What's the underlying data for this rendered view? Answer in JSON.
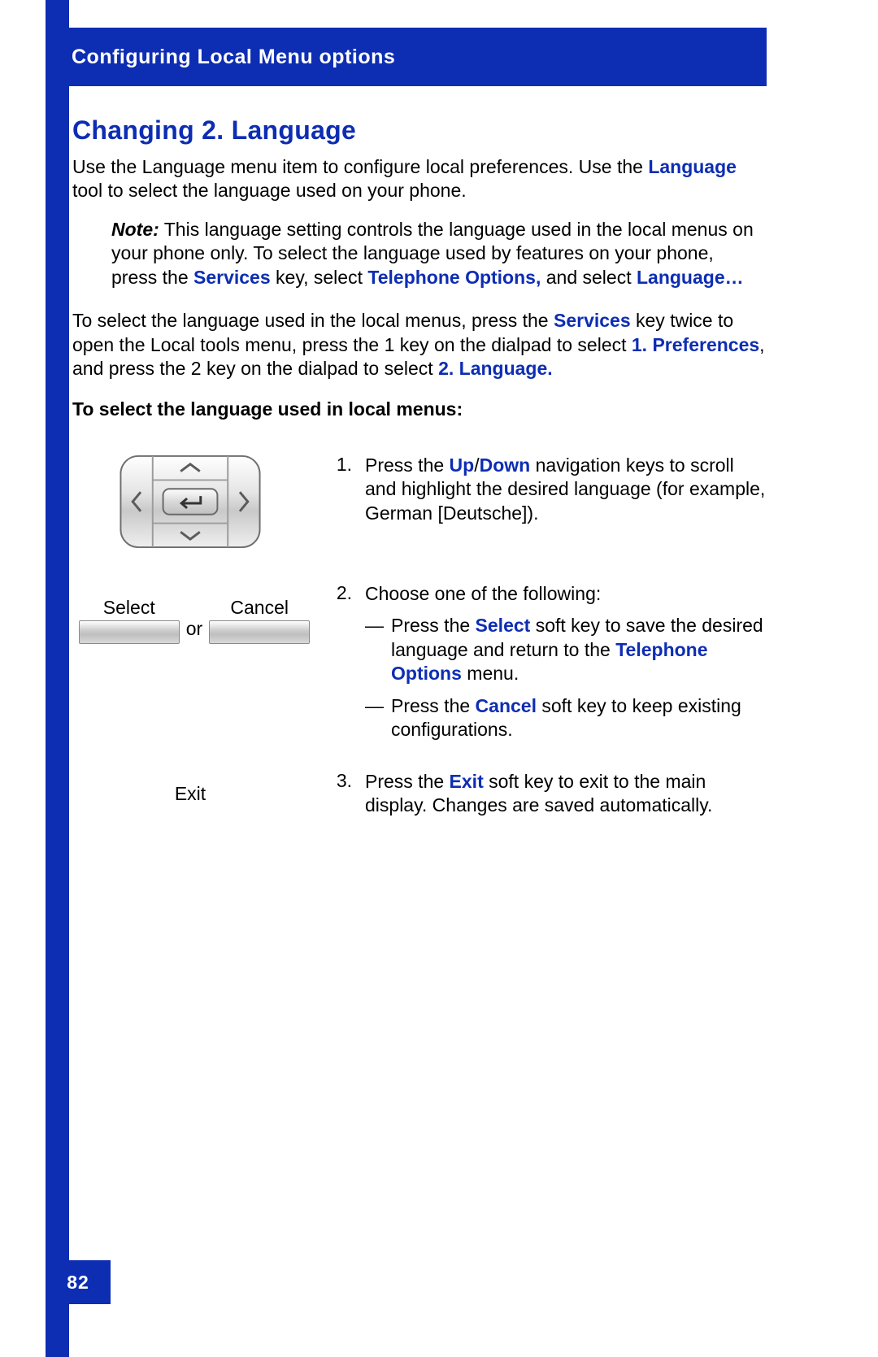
{
  "header": {
    "title": "Configuring Local Menu options"
  },
  "page": {
    "title": "Changing 2. Language",
    "intro_part1": "Use the Language menu item to configure local preferences. Use the ",
    "intro_link": "Language",
    "intro_part2": " tool to select the language used on your phone.",
    "note_label": "Note:",
    "note_pre": " This language setting controls the language used in the local menus on your phone only. To select the language used by features on your phone, press the ",
    "note_services": "Services",
    "note_mid1": " key, select ",
    "note_tel_opts": "Telephone Options,",
    "note_mid2": " and select ",
    "note_lang": "Language…",
    "para2_pre": "To select the language used in the local menus, press the ",
    "para2_services": "Services",
    "para2_mid1": " key twice to open the Local tools menu, press the 1 key on the dialpad to select ",
    "para2_pref": "1. Preferences",
    "para2_mid2": ", and press the 2 key on the dialpad to select ",
    "para2_lang": "2. Language.",
    "subheading": "To select the language used in local menus:"
  },
  "steps": {
    "s1": {
      "num": "1.",
      "pre": "Press the ",
      "up": "Up",
      "slash": "/",
      "down": "Down",
      "post": " navigation keys to scroll and highlight the desired language (for example, German [Deutsche])."
    },
    "s2": {
      "num": "2.",
      "intro": "Choose one of the following:",
      "bullet1_pre": "Press the ",
      "bullet1_select": "Select",
      "bullet1_mid": " soft key to save the desired language and return to the ",
      "bullet1_telopts": "Telephone Options",
      "bullet1_post": " menu.",
      "bullet2_pre": "Press the ",
      "bullet2_cancel": "Cancel",
      "bullet2_post": " soft key to keep existing configurations."
    },
    "s3": {
      "num": "3.",
      "pre": "Press the ",
      "exit": "Exit",
      "post": " soft key to exit to the main display. Changes are saved automatically."
    }
  },
  "softkeys": {
    "select": "Select",
    "or": "or",
    "cancel": "Cancel",
    "exit": "Exit"
  },
  "footer": {
    "page_number": "82"
  }
}
